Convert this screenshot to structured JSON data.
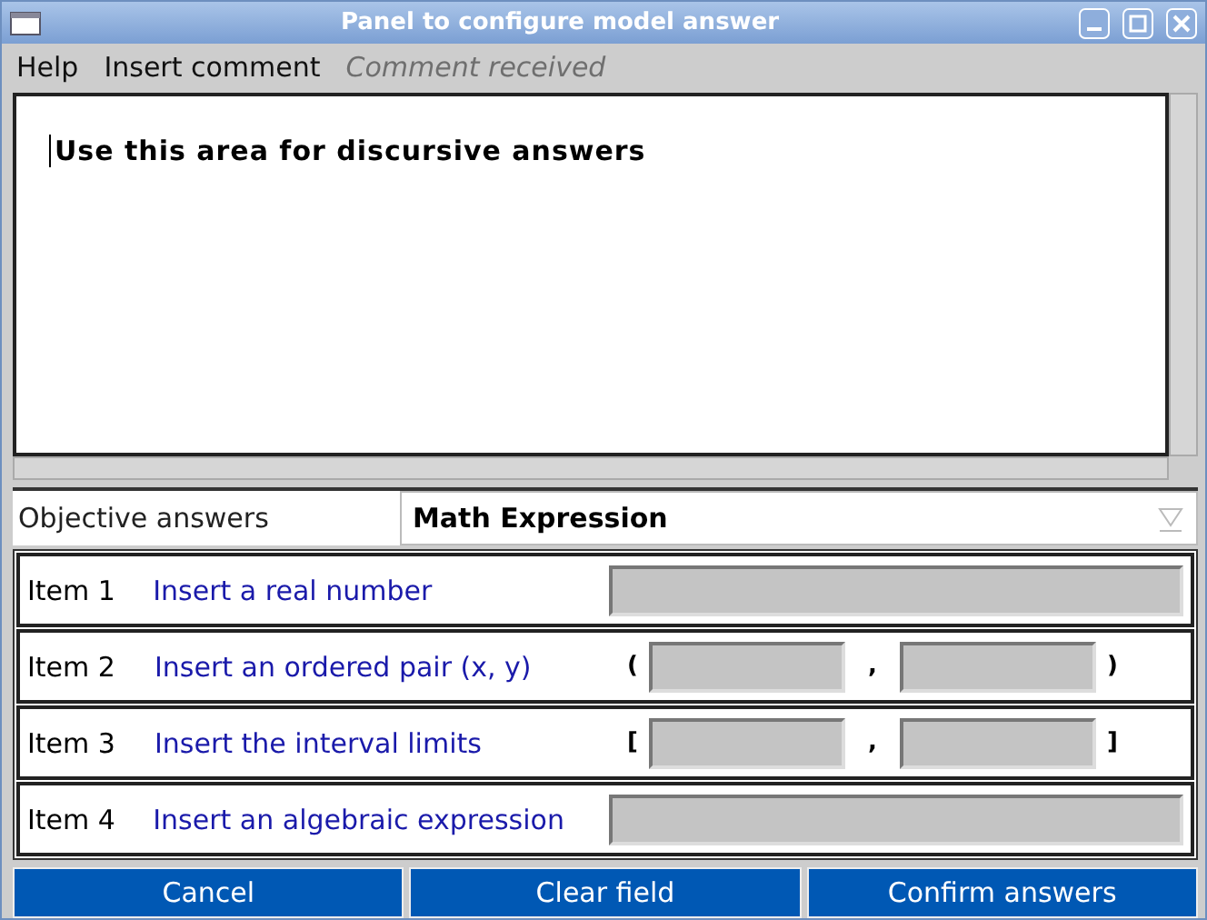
{
  "window": {
    "title": "Panel to configure model answer"
  },
  "menu": [
    {
      "label": "Help",
      "disabled": false
    },
    {
      "label": "Insert comment",
      "disabled": false
    },
    {
      "label": "Comment received",
      "disabled": true
    }
  ],
  "editor": {
    "text": "Use this area for discursive answers"
  },
  "objective": {
    "label": "Objective answers",
    "value": "Math Expression"
  },
  "items": [
    {
      "kind": "single",
      "label": "Item 1",
      "prompt": "Insert a real number"
    },
    {
      "kind": "pair",
      "label": "Item 2",
      "prompt": "Insert an ordered pair (x, y)",
      "open": "(",
      "separator": ",",
      "close": ")"
    },
    {
      "kind": "pair",
      "label": "Item 3",
      "prompt": "Insert the interval limits",
      "open": "[",
      "separator": ",",
      "close": "]"
    },
    {
      "kind": "single",
      "label": "Item 4",
      "prompt": "Insert an algebraic expression"
    }
  ],
  "buttons": [
    "Cancel",
    "Clear field",
    "Confirm answers"
  ]
}
